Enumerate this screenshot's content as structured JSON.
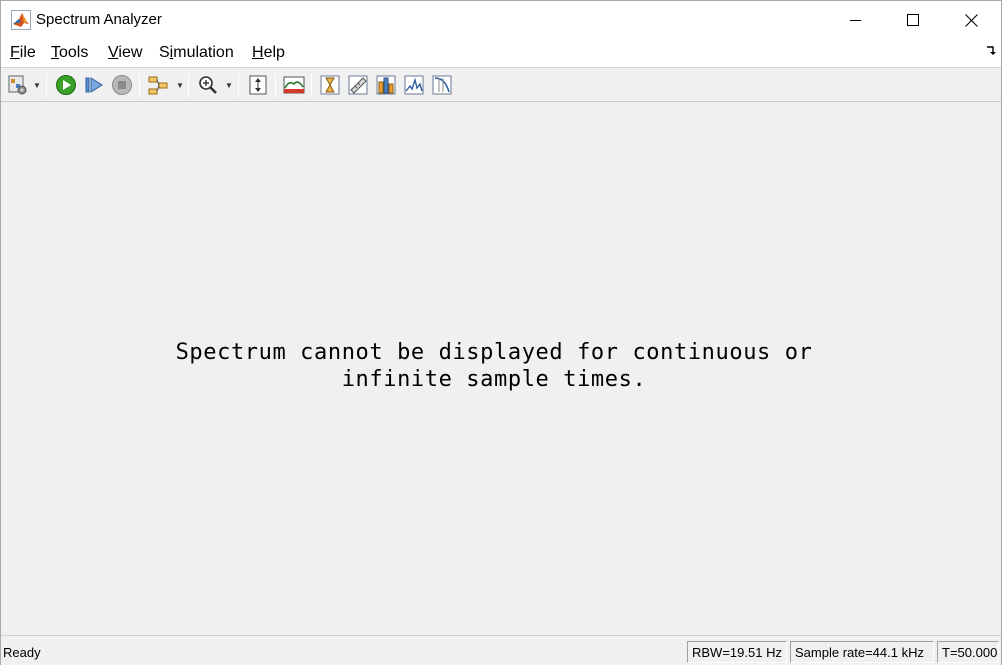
{
  "window": {
    "title": "Spectrum Analyzer"
  },
  "menu": {
    "items": [
      {
        "label_ul": "F",
        "label_rest": "ile"
      },
      {
        "label_ul": "T",
        "label_rest": "ools"
      },
      {
        "label_ul": "V",
        "label_rest": "iew"
      },
      {
        "label_pre": "S",
        "label_ul": "i",
        "label_rest": "mulation"
      },
      {
        "label_ul": "H",
        "label_rest": "elp"
      }
    ]
  },
  "toolbar": {
    "icons": [
      "settings-icon",
      "run-icon",
      "step-forward-icon",
      "stop-icon",
      "signal-select-icon",
      "zoom-in-icon",
      "scale-axes-icon",
      "spectrum-view-icon",
      "data-cursors-icon",
      "measurement-icon",
      "peak-finder-icon",
      "channel-measurement-icon",
      "distortion-measurement-icon"
    ]
  },
  "main": {
    "message_line1": "Spectrum cannot be displayed for continuous or",
    "message_line2": "infinite sample times."
  },
  "status": {
    "ready": "Ready",
    "rbw": "RBW=19.51 Hz",
    "sample_rate": "Sample rate=44.1 kHz",
    "time": "T=50.000"
  },
  "colors": {
    "run_green": "#3aa02a",
    "matlab_orange": "#d9541e",
    "background": "#f0f0f0"
  }
}
